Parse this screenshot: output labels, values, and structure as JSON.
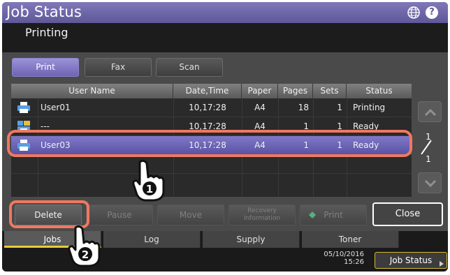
{
  "header": {
    "title": "Job Status",
    "status": "Printing",
    "icons": [
      "globe-icon",
      "help-icon"
    ],
    "help_glyph": "?"
  },
  "tabs": [
    {
      "label": "Print",
      "active": true
    },
    {
      "label": "Fax",
      "active": false
    },
    {
      "label": "Scan",
      "active": false
    }
  ],
  "table": {
    "columns": [
      "User Name",
      "Date,Time",
      "Paper",
      "Pages",
      "Sets",
      "Status"
    ],
    "rows": [
      {
        "icon": "printer-icon",
        "user": "User01",
        "datetime": "10,17:28",
        "paper": "A4",
        "pages": "18",
        "sets": "1",
        "status": "Printing",
        "selected": false
      },
      {
        "icon": "scan-print-icon",
        "user": "---",
        "datetime": "10,17:28",
        "paper": "A4",
        "pages": "1",
        "sets": "1",
        "status": "Ready",
        "selected": false
      },
      {
        "icon": "printer-icon",
        "user": "User03",
        "datetime": "10,17:28",
        "paper": "A4",
        "pages": "1",
        "sets": "1",
        "status": "Ready",
        "selected": true
      }
    ]
  },
  "pagination": {
    "current": "1",
    "total": "1"
  },
  "actions": {
    "delete": "Delete",
    "pause": "Pause",
    "move": "Move",
    "recovery_line1": "Recovery",
    "recovery_line2": "Information",
    "print": "Print",
    "close": "Close"
  },
  "nav": [
    {
      "label": "Jobs",
      "active": true
    },
    {
      "label": "Log",
      "active": false
    },
    {
      "label": "Supply",
      "active": false
    },
    {
      "label": "Toner",
      "active": false
    }
  ],
  "footer": {
    "date": "05/10/2016",
    "time": "15:26",
    "job_status": "Job Status"
  },
  "callouts": {
    "step1": "1",
    "step2": "2"
  },
  "colors": {
    "accent": "#6d65b4",
    "highlight": "#f07860",
    "active_tab_underline": "#e8cc3a"
  }
}
